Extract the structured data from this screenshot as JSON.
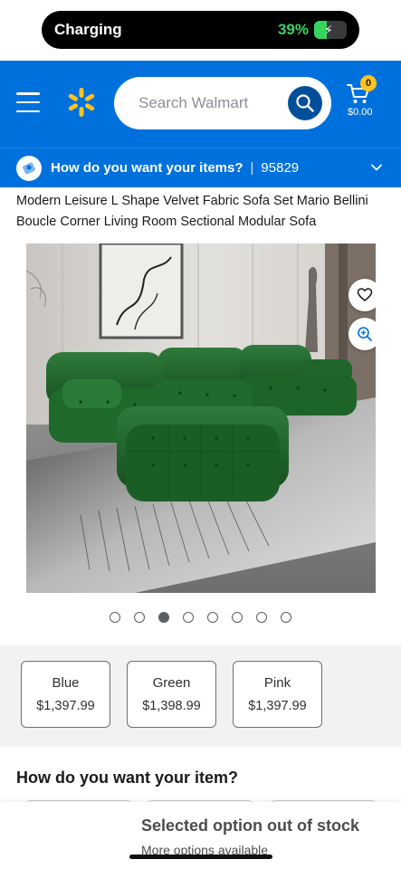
{
  "status": {
    "charging_label": "Charging",
    "battery_percent_label": "39%",
    "battery_level": 0.39,
    "accent_color": "#35d55d"
  },
  "header": {
    "brand_color": "#0071dc",
    "menu_icon": "hamburger-menu-icon",
    "logo_icon": "walmart-spark-icon",
    "search": {
      "placeholder": "Search Walmart",
      "icon": "search-icon"
    },
    "cart": {
      "icon": "cart-icon",
      "badge_count": "0",
      "total": "$0.00"
    }
  },
  "delivery": {
    "prompt": "How do you want your items?",
    "separator": "|",
    "zip": "95829",
    "icon": "delivery-location-icon",
    "chevron": "chevron-down-icon"
  },
  "product": {
    "title": "Modern Leisure L Shape Velvet Fabric Sofa Set Mario Bellini Boucle Corner Living Room Sectional Modular Sofa",
    "image_icons": [
      "heart-icon",
      "zoom-in-icon"
    ],
    "carousel": {
      "total": 8,
      "active_index": 2
    }
  },
  "variants": [
    {
      "name": "Blue",
      "price": "$1,397.99"
    },
    {
      "name": "Green",
      "price": "$1,398.99"
    },
    {
      "name": "Pink",
      "price": "$1,397.99"
    }
  ],
  "fulfillment": {
    "heading": "How do you want your item?"
  },
  "notice": {
    "message": "Selected option out of stock",
    "link": "More options available"
  }
}
